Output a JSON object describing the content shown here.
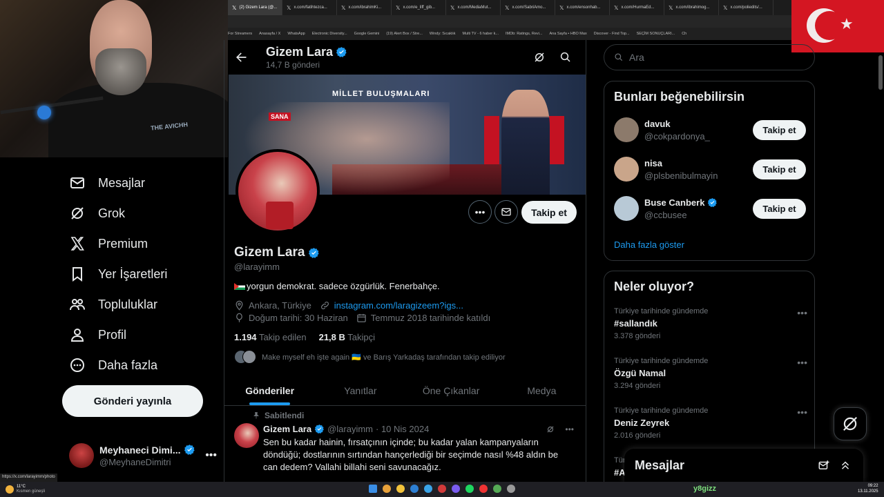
{
  "browser": {
    "tabs": [
      "(2) Gizem Lara (@...",
      "x.com/fatihtezca...",
      "x.com/ibrahimKi...",
      "x.com/e_liff_gib...",
      "x.com/MediaMut...",
      "x.com/SabriAmo...",
      "x.com/ensonhab...",
      "x.com/HurmaEd...",
      "x.com/ibrahimog...",
      "x.com/poliedits/..."
    ],
    "bookmarks": [
      "For Streamers",
      "Anasayfa / X",
      "WhatsApp",
      "Electronic Diversity...",
      "Google Gemini",
      "(19) Alert Box / Stre...",
      "Windy: Sıcaklık",
      "Multi TV - 6 haber k...",
      "IMDb: Ratings, Revi...",
      "Ana Sayfa • HBO Max",
      "Discover - Find Top...",
      "SEÇİM SONUÇLARI...",
      "Ch"
    ],
    "status_url": "https://x.com/larayimm/photo"
  },
  "webcam": {
    "shirt_text": "THE AVICHH"
  },
  "nav": {
    "items": [
      {
        "label": "Mesajlar",
        "icon": "mail-icon"
      },
      {
        "label": "Grok",
        "icon": "grok-icon"
      },
      {
        "label": "Premium",
        "icon": "x-logo-icon"
      },
      {
        "label": "Yer İşaretleri",
        "icon": "bookmark-icon"
      },
      {
        "label": "Topluluklar",
        "icon": "communities-icon"
      },
      {
        "label": "Profil",
        "icon": "person-icon"
      },
      {
        "label": "Daha fazla",
        "icon": "more-circle-icon"
      }
    ],
    "post_button": "Gönderi yayınla",
    "account": {
      "name": "Meyhaneci Dimi...",
      "handle": "@MeyhaneDimitri"
    }
  },
  "profile": {
    "header_name": "Gizem Lara",
    "header_posts": "14,7 B gönderi",
    "banner_text": "MİLLET BULUŞMALARI",
    "banner_sign": "SANA",
    "name": "Gizem Lara",
    "handle": "@larayimm",
    "bio": "yorgun demokrat. sadece özgürlük. Fenerbahçe.",
    "location": "Ankara, Türkiye",
    "link": "instagram.com/laragizeem?igs...",
    "birthday": "Doğum tarihi: 30 Haziran",
    "joined": "Temmuz 2018 tarihinde katıldı",
    "following_count": "1.194",
    "following_label": "Takip edilen",
    "followers_count": "21,8 B",
    "followers_label": "Takipçi",
    "followed_by": "Make myself eh işte again 🇺🇦 ve Barış Yarkadaş tarafından takip ediliyor",
    "follow_button": "Takip et",
    "tabs": [
      "Gönderiler",
      "Yanıtlar",
      "Öne Çıkanlar",
      "Medya"
    ],
    "pinned_label": "Sabitlendi",
    "post": {
      "name": "Gizem Lara",
      "handle": "@larayimm",
      "date": "· 10 Nis 2024",
      "text": "Sen bu kadar hainin, fırsatçının içinde; bu kadar yalan kampanyaların döndüğü; dostlarının sırtından hançerlediği bir seçimde nasıl %48 aldın be can dedem? Vallahi billahi seni savunacağız."
    }
  },
  "right": {
    "search_placeholder": "Ara",
    "suggest_title": "Bunları beğenebilirsin",
    "suggestions": [
      {
        "name": "davuk",
        "handle": "@cokpardonya_",
        "button": "Takip et",
        "color": "#8c7a6b"
      },
      {
        "name": "nisa",
        "handle": "@plsbenibulmayin",
        "button": "Takip et",
        "color": "#c9a58a"
      },
      {
        "name": "Buse Canberk",
        "handle": "@ccbusee",
        "button": "Takip et",
        "color": "#b8c9d6"
      }
    ],
    "show_more": "Daha fazla göster",
    "trends_title": "Neler oluyor?",
    "trends": [
      {
        "context": "Türkiye tarihinde gündemde",
        "name": "#sallandık",
        "count": "3.378 gönderi"
      },
      {
        "context": "Türkiye tarihinde gündemde",
        "name": "Özgü Namal",
        "count": "3.294 gönderi"
      },
      {
        "context": "Türkiye tarihinde gündemde",
        "name": "Deniz Zeyrek",
        "count": "2.016 gönderi"
      },
      {
        "context": "Tür",
        "name": "#A"
      }
    ],
    "messages_title": "Mesajlar"
  },
  "taskbar": {
    "weather_temp": "11°C",
    "weather_text": "Kısmen güneşli",
    "center_text": "y8gizz",
    "time": "09:22",
    "date": "13.11.2025"
  },
  "colors": {
    "accent": "#1d9bf0",
    "verified": "#1d9bf0",
    "flag_red": "#d41622"
  }
}
